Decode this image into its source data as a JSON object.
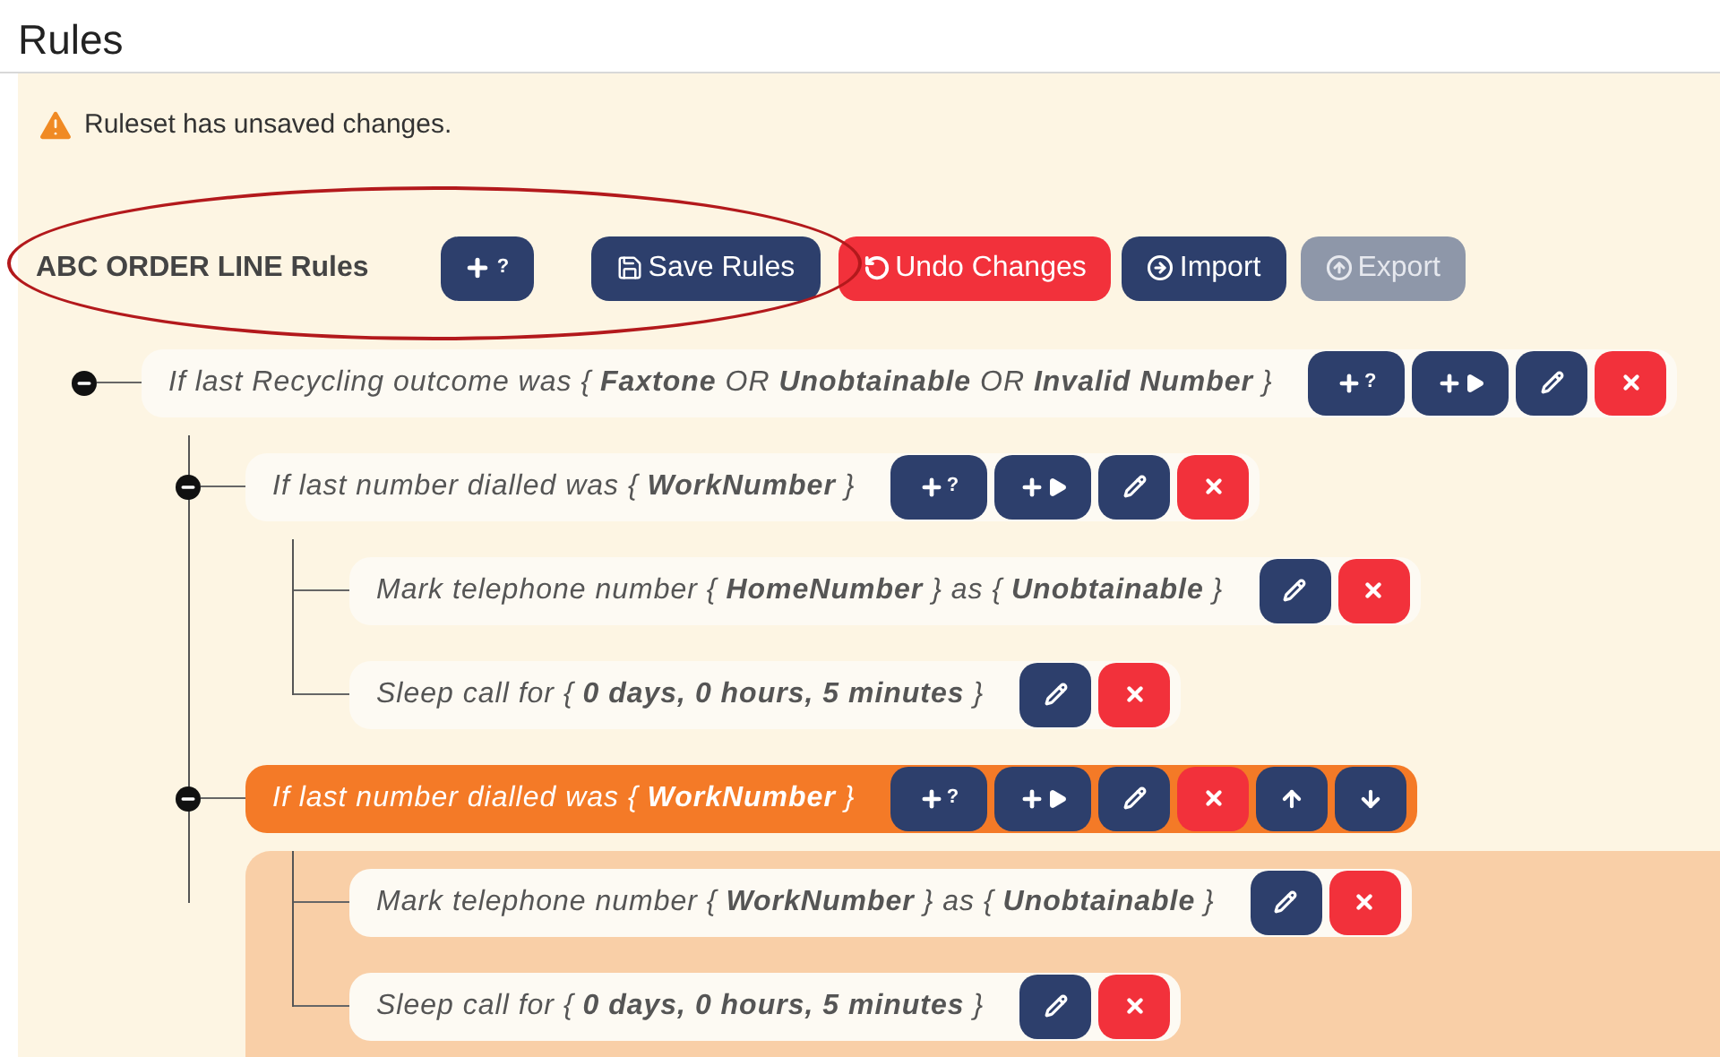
{
  "page_title": "Rules",
  "warning": "Ruleset has unsaved changes.",
  "highlight_ellipse": true,
  "toolbar": {
    "label": "ABC ORDER LINE Rules",
    "buttons": [
      {
        "kind": "add_condition",
        "label": "?",
        "disabled": false
      },
      {
        "kind": "save",
        "label": "Save Rules",
        "disabled": false
      },
      {
        "kind": "undo",
        "label": "Undo Changes",
        "disabled": false
      },
      {
        "kind": "import",
        "label": "Import",
        "disabled": false
      },
      {
        "kind": "export",
        "label": "Export",
        "disabled": true
      }
    ]
  },
  "tree": [
    {
      "kind": "condition",
      "text": "If last Recycling outcome was { **Faxtone** OR **Unobtainable** OR **Invalid Number** }",
      "expanded": true,
      "selected": false,
      "buttons": [
        {
          "kind": "add_condition",
          "label": "?"
        },
        {
          "kind": "add_action"
        },
        {
          "kind": "edit"
        },
        {
          "kind": "delete"
        }
      ],
      "children": [
        {
          "kind": "condition",
          "text": "If last number dialled was { **WorkNumber** }",
          "expanded": true,
          "selected": false,
          "buttons": [
            {
              "kind": "add_condition",
              "label": "?"
            },
            {
              "kind": "add_action"
            },
            {
              "kind": "edit"
            },
            {
              "kind": "delete"
            }
          ],
          "children": [
            {
              "kind": "action",
              "text": "Mark telephone number { **HomeNumber** } as { **Unobtainable** }",
              "selected": false,
              "buttons": [
                {
                  "kind": "edit"
                },
                {
                  "kind": "delete"
                }
              ]
            },
            {
              "kind": "action",
              "text": "Sleep call for { **0 days, 0 hours, 5 minutes** }",
              "selected": false,
              "buttons": [
                {
                  "kind": "edit"
                },
                {
                  "kind": "delete"
                }
              ]
            }
          ]
        },
        {
          "kind": "condition",
          "text": "If last number dialled was { **WorkNumber** }",
          "expanded": true,
          "selected": true,
          "buttons": [
            {
              "kind": "add_condition",
              "label": "?"
            },
            {
              "kind": "add_action"
            },
            {
              "kind": "edit"
            },
            {
              "kind": "delete"
            },
            {
              "kind": "up"
            },
            {
              "kind": "down"
            }
          ],
          "children": [
            {
              "kind": "action",
              "text": "Mark telephone number { **WorkNumber** } as { **Unobtainable** }",
              "selected": false,
              "buttons": [
                {
                  "kind": "edit"
                },
                {
                  "kind": "delete"
                }
              ]
            },
            {
              "kind": "action",
              "text": "Sleep call for { **0 days, 0 hours, 5 minutes** }",
              "selected": false,
              "buttons": [
                {
                  "kind": "edit"
                },
                {
                  "kind": "delete"
                }
              ]
            }
          ]
        }
      ]
    }
  ]
}
